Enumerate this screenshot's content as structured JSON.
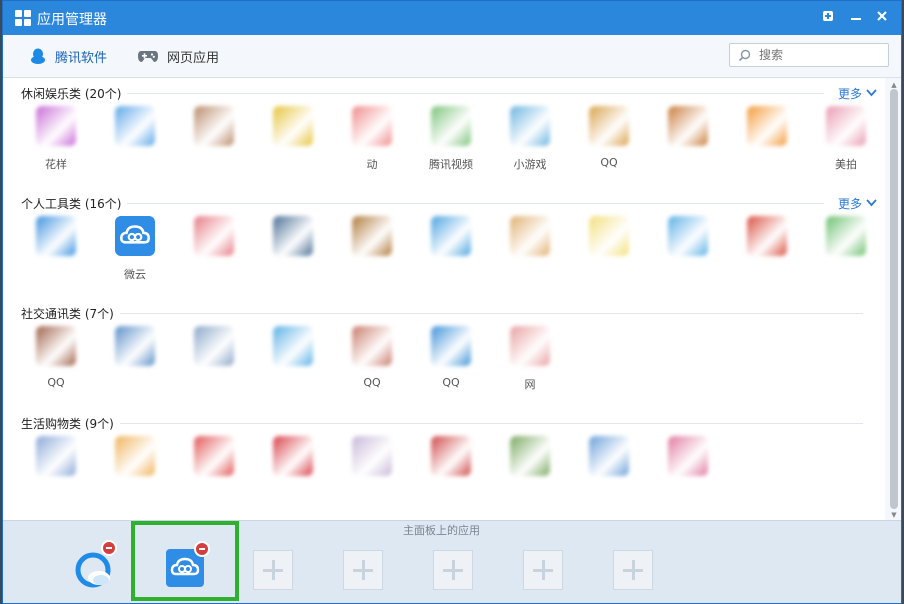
{
  "window": {
    "title": "应用管理器"
  },
  "toolbar": {
    "tabs": [
      {
        "label": "腾讯软件"
      },
      {
        "label": "网页应用"
      }
    ],
    "search_placeholder": "搜索"
  },
  "categories": [
    {
      "title": "休闲娱乐类 (20个)",
      "more": "更多",
      "apps": [
        {
          "label": "花样"
        },
        {
          "label": ""
        },
        {
          "label": ""
        },
        {
          "label": ""
        },
        {
          "label": "动"
        },
        {
          "label": "腾讯视频"
        },
        {
          "label": "小游戏"
        },
        {
          "label": "QQ"
        },
        {
          "label": ""
        },
        {
          "label": ""
        },
        {
          "label": "美拍"
        }
      ]
    },
    {
      "title": "个人工具类 (16个)",
      "more": "更多",
      "apps": [
        {
          "label": ""
        },
        {
          "label": "微云"
        },
        {
          "label": ""
        },
        {
          "label": ""
        },
        {
          "label": ""
        },
        {
          "label": ""
        },
        {
          "label": ""
        },
        {
          "label": ""
        },
        {
          "label": ""
        },
        {
          "label": ""
        },
        {
          "label": ""
        }
      ]
    },
    {
      "title": "社交通讯类 (7个)",
      "more": "",
      "apps": [
        {
          "label": "QQ"
        },
        {
          "label": ""
        },
        {
          "label": ""
        },
        {
          "label": ""
        },
        {
          "label": "QQ"
        },
        {
          "label": "QQ"
        },
        {
          "label": "网"
        }
      ]
    },
    {
      "title": "生活购物类 (9个)",
      "more": "",
      "apps": [
        {
          "label": ""
        },
        {
          "label": ""
        },
        {
          "label": ""
        },
        {
          "label": ""
        },
        {
          "label": ""
        },
        {
          "label": ""
        },
        {
          "label": ""
        },
        {
          "label": ""
        },
        {
          "label": ""
        }
      ]
    }
  ],
  "dock": {
    "caption": "主面板上的应用"
  }
}
